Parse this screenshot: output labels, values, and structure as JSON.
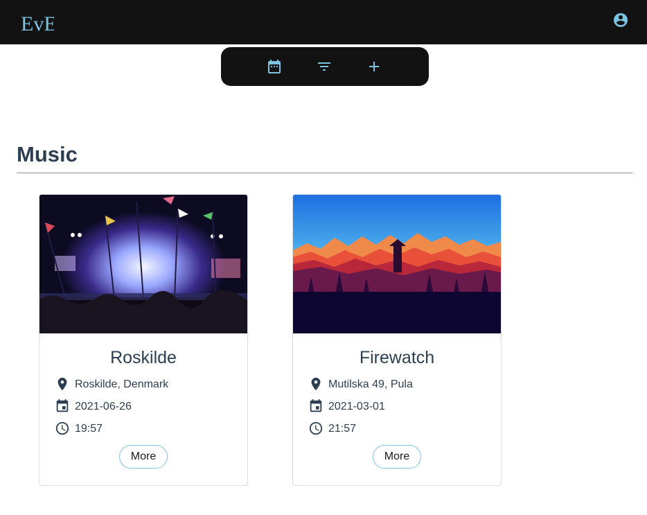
{
  "header": {
    "logo_text": "EvE",
    "logo_icon": "eve-logo",
    "account_icon": "account-circle-icon",
    "accent_color": "#7cc3e0",
    "background_color": "#121212"
  },
  "toolbar": {
    "buttons": [
      {
        "icon": "calendar-icon"
      },
      {
        "icon": "filter-icon"
      },
      {
        "icon": "plus-icon"
      }
    ]
  },
  "section": {
    "title": "Music"
  },
  "events": [
    {
      "title": "Roskilde",
      "location": "Roskilde, Denmark",
      "date": "2021-06-26",
      "time": "19:57",
      "more_label": "More",
      "image": "festival-stage-photo"
    },
    {
      "title": "Firewatch",
      "location": "Mutilska 49, Pula",
      "date": "2021-03-01",
      "time": "21:57",
      "more_label": "More",
      "image": "mountain-sunset-illustration"
    }
  ]
}
